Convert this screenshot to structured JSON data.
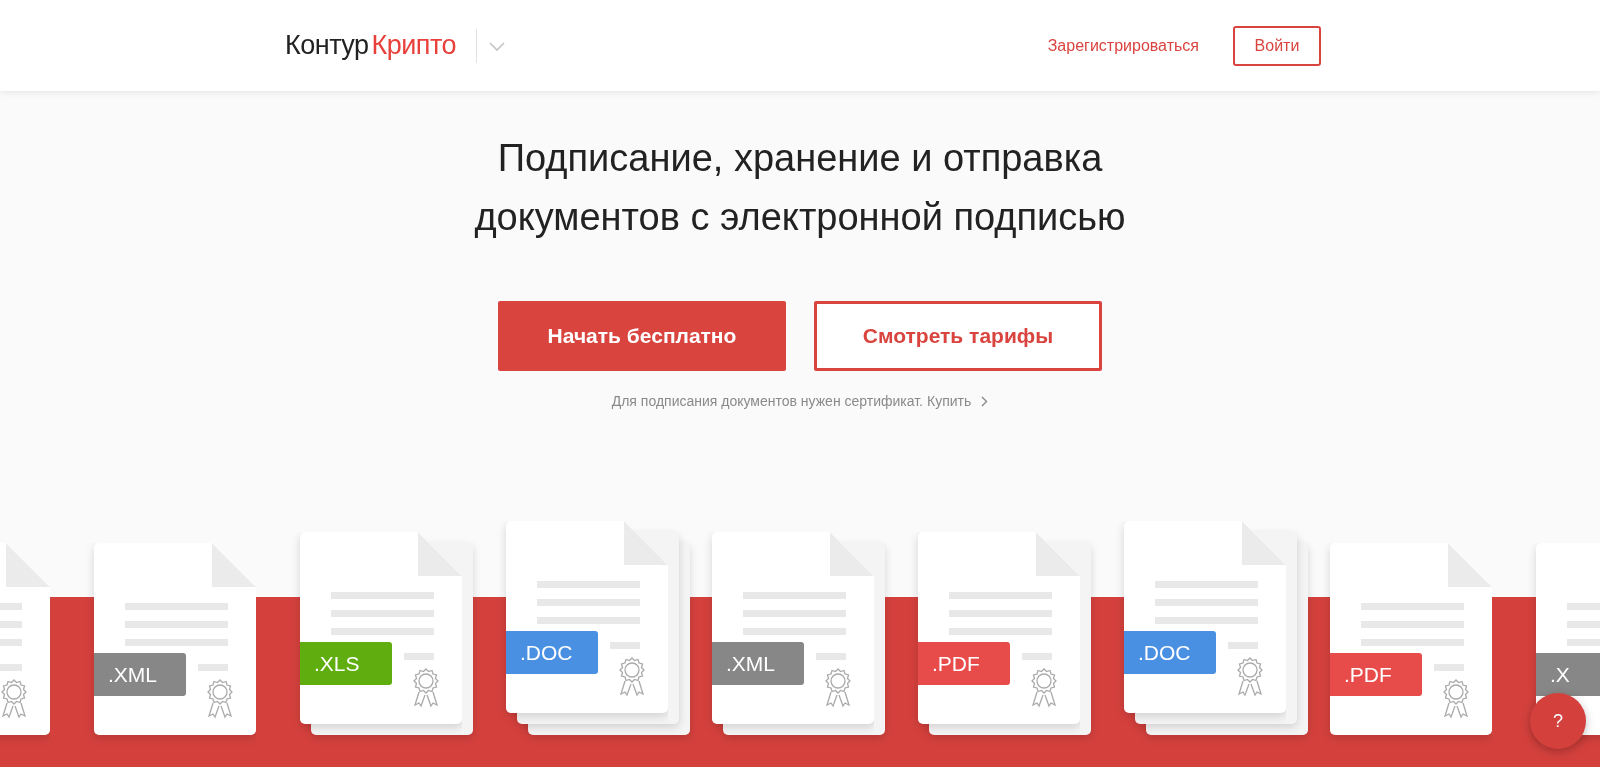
{
  "header": {
    "logo": {
      "first": "Контур",
      "second": "Крипто"
    },
    "register_link": "Зарегистрироваться",
    "login_button": "Войти"
  },
  "hero": {
    "title_lines": [
      "Подписание, хранение и отправка",
      "документов с электронной подписью"
    ],
    "primary_button": "Начать бесплатно",
    "secondary_button": "Смотреть тарифы",
    "note": {
      "text": "Для подписания документов нужен сертификат.",
      "link": "Купить"
    }
  },
  "documents": [
    {
      "kind": "single"
    },
    {
      "kind": "single",
      "tag": ".XML",
      "color": "#878787"
    },
    {
      "kind": "double",
      "tag": ".XLS",
      "color": "#5fad0e"
    },
    {
      "kind": "triple",
      "tag": ".DOC",
      "color": "#4a90e2"
    },
    {
      "kind": "double",
      "tag": ".XML",
      "color": "#878787"
    },
    {
      "kind": "double",
      "tag": ".PDF",
      "color": "#e84c4a"
    },
    {
      "kind": "triple",
      "tag": ".DOC",
      "color": "#4a90e2"
    },
    {
      "kind": "single",
      "tag": ".PDF",
      "color": "#e84c4a"
    },
    {
      "kind": "cut",
      "tag": ".X",
      "color": "#878787"
    }
  ],
  "help_button": "?"
}
